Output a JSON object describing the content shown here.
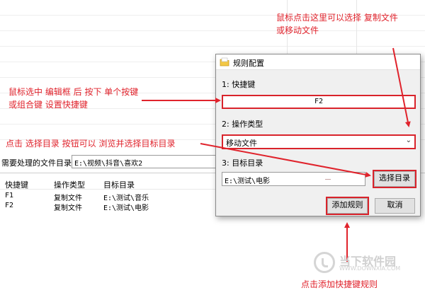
{
  "main": {
    "dir_label": "需要处理的文件目录:",
    "dir_value": "E:\\视频\\抖音\\喜欢2",
    "list": {
      "headers": [
        "快捷键",
        "操作类型",
        "目标目录"
      ],
      "rows": [
        [
          "F1",
          "复制文件",
          "E:\\测试\\音乐"
        ],
        [
          "F2",
          "复制文件",
          "E:\\测试\\电影"
        ]
      ]
    }
  },
  "dialog": {
    "title": "规则配置",
    "label_hotkey": "1: 快捷键",
    "hotkey_value": "F2",
    "label_op": "2: 操作类型",
    "op_value": "移动文件",
    "label_target": "3: 目标目录",
    "target_value": "E:\\测试\\电影",
    "browse_label": "选择目录",
    "add_label": "添加规则",
    "cancel_label": "取消"
  },
  "annotations": {
    "a1_line1": "鼠标点击这里可以选择 复制文件",
    "a1_line2": "或移动文件",
    "a2_line1": "鼠标选中 编辑框 后 按下 单个按键",
    "a2_line2": "或组合键 设置快捷键",
    "a3": "点击 选择目录 按钮可以 浏览并选择目标目录",
    "a4": "点击添加快捷键规则"
  },
  "watermark": {
    "text": "当下软件园",
    "url": "WWW.DOWNXIA.COM"
  },
  "colors": {
    "annotation_red": "#e0232c",
    "highlight_red": "#d9232b",
    "dialog_bg": "#f0f0f0",
    "button_bg": "#e1e1e1"
  }
}
